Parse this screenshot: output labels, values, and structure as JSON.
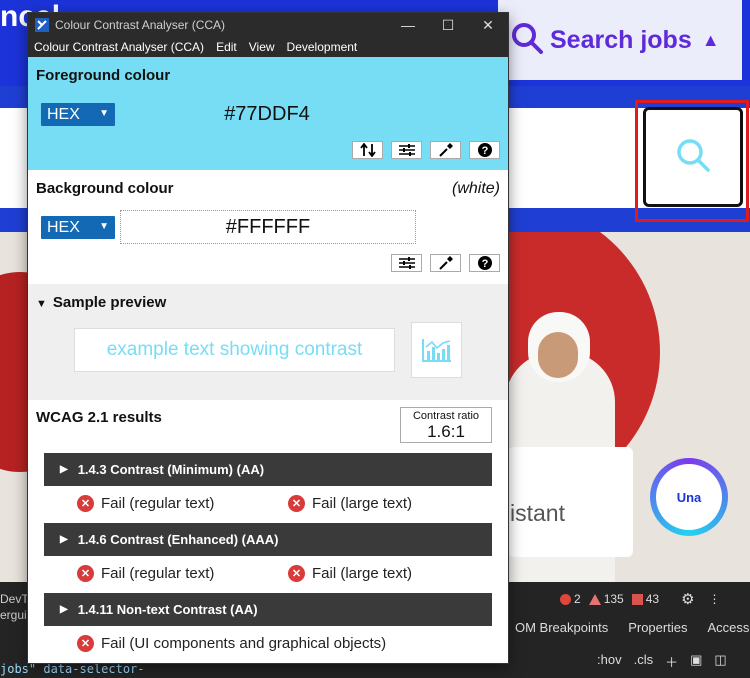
{
  "background": {
    "site_title": "ncel",
    "search_jobs_label": "Search jobs",
    "assistant_text": "istant",
    "badge_label": "Una"
  },
  "devtools": {
    "left_lines": [
      "DevTo",
      "ergui"
    ],
    "errors_count": "2",
    "warnings_count": "135",
    "issues_count": "43",
    "tabs": [
      "OM Breakpoints",
      "Properties",
      "Accessib"
    ],
    "tools": [
      ":hov",
      ".cls"
    ],
    "code_text": "jobs\" data-selector-"
  },
  "cca": {
    "window_title": "Colour Contrast Analyser (CCA)",
    "menu": [
      "Colour Contrast Analyser (CCA)",
      "Edit",
      "View",
      "Development"
    ],
    "foreground": {
      "title": "Foreground colour",
      "format": "HEX",
      "value": "#77DDF4",
      "color": "#77ddf4"
    },
    "background_colour": {
      "title": "Background colour",
      "name": "(white)",
      "format": "HEX",
      "value": "#FFFFFF",
      "color": "#ffffff"
    },
    "preview": {
      "title": "Sample preview",
      "sample_text": "example text showing contrast"
    },
    "results": {
      "title": "WCAG 2.1 results",
      "ratio_label": "Contrast ratio",
      "ratio_value": "1.6:1",
      "criteria": [
        {
          "label": "1.4.3 Contrast (Minimum) (AA)",
          "results": [
            "Fail (regular text)",
            "Fail (large text)"
          ]
        },
        {
          "label": "1.4.6 Contrast (Enhanced) (AAA)",
          "results": [
            "Fail (regular text)",
            "Fail (large text)"
          ]
        },
        {
          "label": "1.4.11 Non-text Contrast (AA)",
          "results": [
            "Fail (UI components and graphical objects)"
          ]
        }
      ]
    }
  },
  "colors": {
    "site_blue": "#1c33d9",
    "fail_red": "#d93a3a",
    "select_blue": "#1369b4",
    "highlight_red": "#e01b1b"
  }
}
